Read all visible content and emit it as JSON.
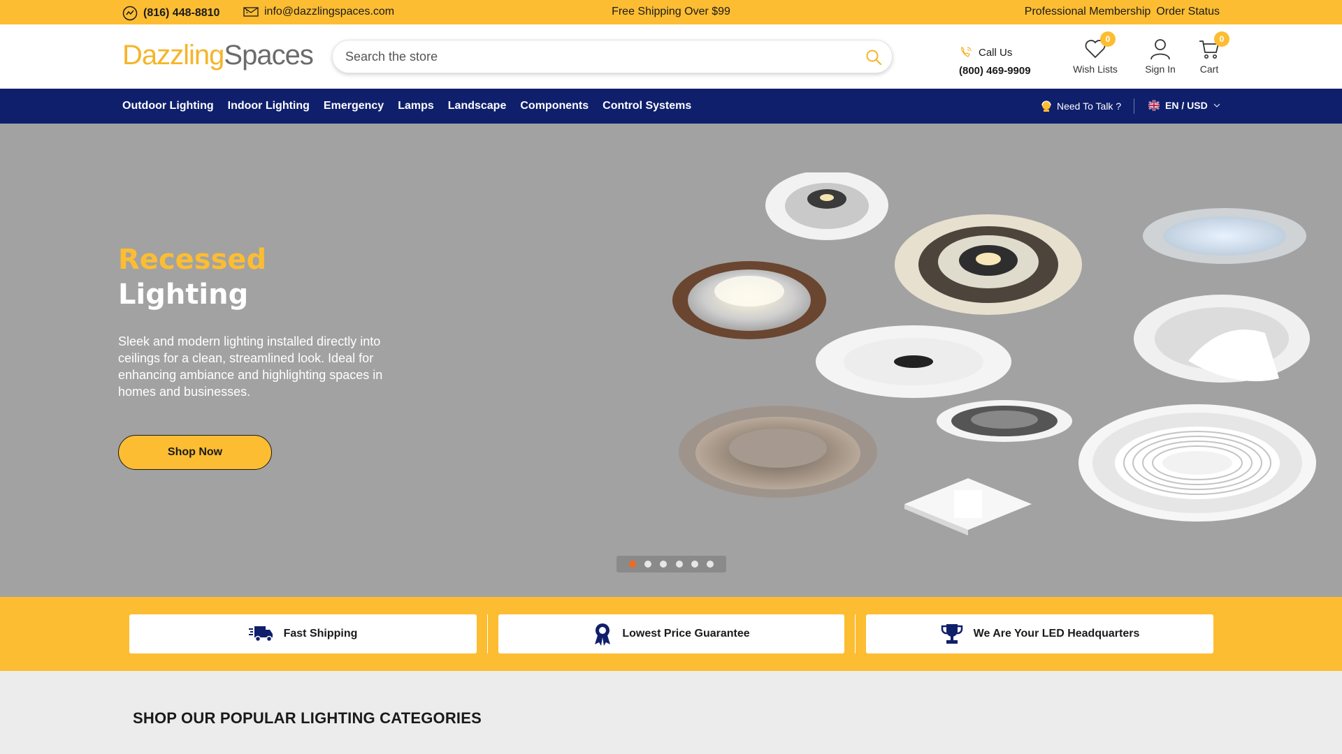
{
  "topbar": {
    "phone": "(816) 448-8810",
    "email": "info@dazzlingspaces.com",
    "shipping": "Free Shipping Over $99",
    "links": [
      "Professional Membership",
      "Order Status"
    ]
  },
  "header": {
    "logo_part1": "Dazzling",
    "logo_part2": "Spaces",
    "search_placeholder": "Search the store",
    "call_label": "Call Us",
    "call_number": "(800) 469-9909",
    "wishlist_label": "Wish Lists",
    "wishlist_count": "0",
    "signin_label": "Sign In",
    "cart_label": "Cart",
    "cart_count": "0"
  },
  "nav": {
    "items": [
      "Outdoor Lighting",
      "Indoor Lighting",
      "Emergency",
      "Lamps",
      "Landscape",
      "Components",
      "Control Systems"
    ],
    "talk": "Need To Talk ?",
    "lang": "EN / USD"
  },
  "hero": {
    "title_line1": "Recessed",
    "title_line2": "Lighting",
    "description": "Sleek and modern lighting installed directly into ceilings for a clean, streamlined look. Ideal for enhancing ambiance and highlighting spaces in homes and businesses.",
    "cta": "Shop Now",
    "slide_count": 6,
    "active_slide": 1
  },
  "features": [
    "Fast Shipping",
    "Lowest Price Guarantee",
    "We Are Your LED Headquarters"
  ],
  "categories": {
    "heading": "SHOP OUR POPULAR LIGHTING CATEGORIES"
  },
  "colors": {
    "accent": "#fcbd32",
    "nav_bg": "#0f1f6b",
    "hero_bg": "#a2a2a2",
    "active_dot": "#f26a21"
  }
}
